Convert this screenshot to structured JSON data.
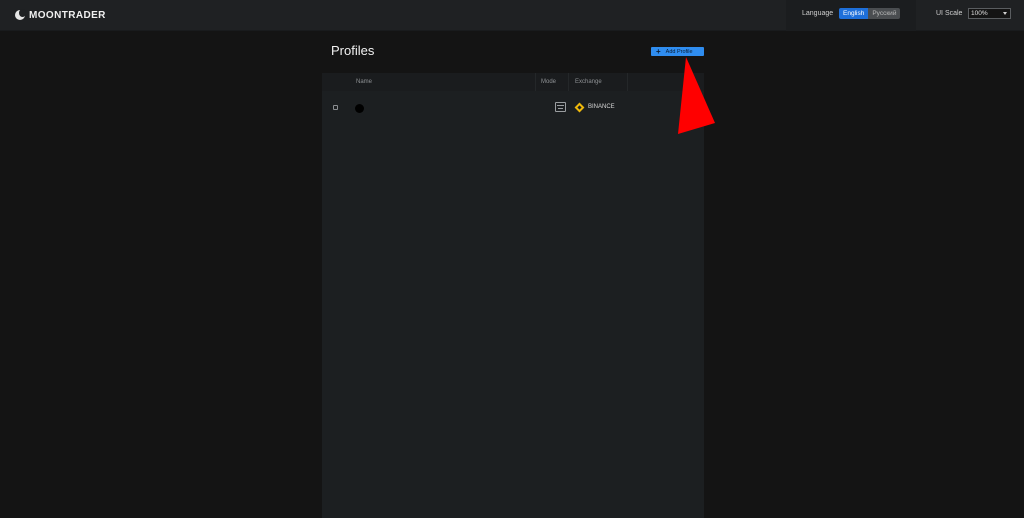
{
  "app": {
    "logo_text": "MOONTRADER"
  },
  "topbar": {
    "language_label": "Language",
    "languages": [
      {
        "label": "English",
        "active": true
      },
      {
        "label": "Русский",
        "active": false
      }
    ],
    "ui_scale_label": "UI Scale",
    "ui_scale_value": "100%"
  },
  "page": {
    "title": "Profiles",
    "add_button_label": "Add Profile"
  },
  "table": {
    "columns": [
      "Name",
      "Mode",
      "Exchange"
    ],
    "rows": [
      {
        "name": "",
        "mode_icon": "terminal-icon",
        "exchange": "BINANCE"
      }
    ]
  },
  "colors": {
    "accent": "#2f8df0",
    "language_active": "#1e6fd9",
    "binance": "#f0b90b",
    "annotation_arrow": "#ff0000"
  }
}
